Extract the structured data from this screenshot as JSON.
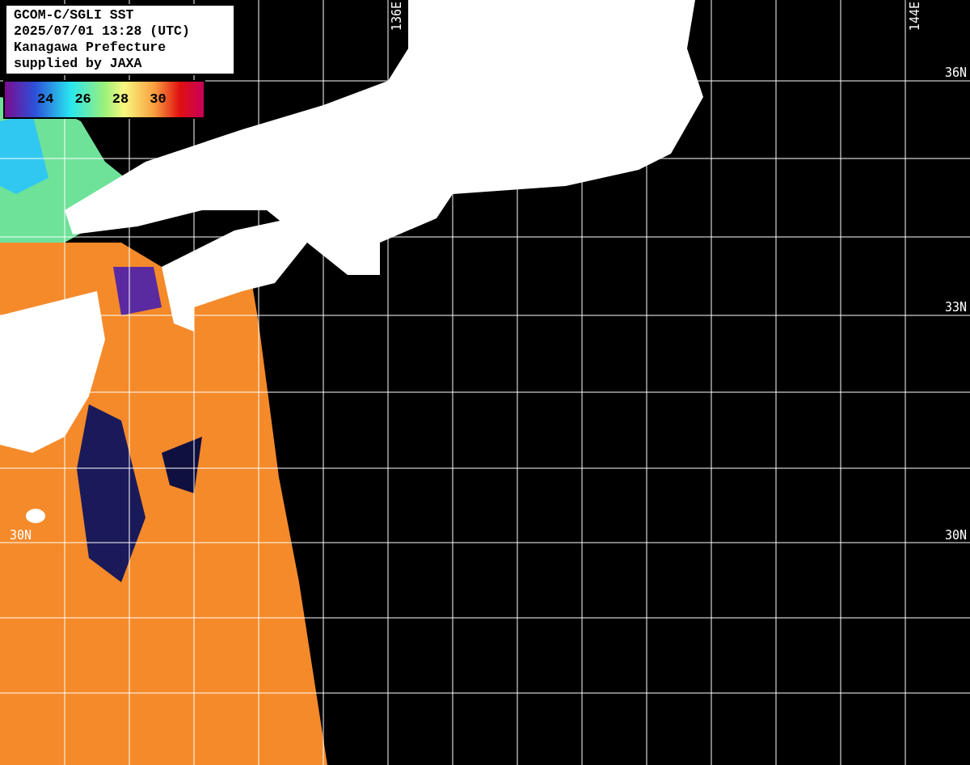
{
  "title_box": {
    "lines": [
      "GCOM-C/SGLI SST",
      "2025/07/01 13:28 (UTC)",
      "Kanagawa Prefecture",
      "supplied by JAXA"
    ]
  },
  "legend": {
    "labels": [
      "24",
      "26",
      "28",
      "30"
    ]
  },
  "grid_labels": {
    "longitude_top": [
      "136E",
      "144E"
    ],
    "latitude_right": [
      "36N",
      "33N",
      "30N"
    ],
    "latitude_left": [
      "30N"
    ]
  }
}
